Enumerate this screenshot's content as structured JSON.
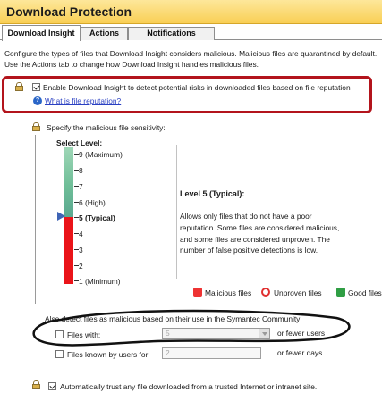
{
  "window": {
    "title": "Download Protection"
  },
  "tabs": [
    {
      "label": "Download Insight",
      "active": true
    },
    {
      "label": "Actions",
      "active": false
    },
    {
      "label": "Notifications",
      "active": false
    }
  ],
  "description": {
    "line1": "Configure the types of files that Download Insight considers malicious. Malicious files are quarantined by default.",
    "line2": "Use the Actions tab to change how Download Insight handles malicious files."
  },
  "enable_option": {
    "label": "Enable Download Insight to detect potential risks in downloaded files based on file reputation",
    "checked": true,
    "help_link": "What is file reputation?"
  },
  "sensitivity": {
    "heading": "Specify the malicious file sensitivity:",
    "select_label": "Select Level:",
    "levels": [
      "9 (Maximum)",
      "8",
      "7",
      "6 (High)",
      "5 (Typical)",
      "4",
      "3",
      "2",
      "1 (Minimum)"
    ],
    "selected_level": 5,
    "info_title": "Level 5 (Typical):",
    "info_text": "Allows only files that do not have a poor reputation. Some files are considered malicious, and some files are considered unproven. The number of false positive detections is low.",
    "legend": [
      "Malicious files",
      "Unproven files",
      "Good files"
    ]
  },
  "community": {
    "heading": "Also detect files as malicious based on their use in the Symantec Community:",
    "files_with_label": "Files with:",
    "files_with_checked": false,
    "files_with_value": "5",
    "files_with_suffix": "or fewer users",
    "known_by_label": "Files known by users for:",
    "known_by_checked": false,
    "known_by_value": "2",
    "known_by_suffix": "or fewer days"
  },
  "trust_option": {
    "label": "Automatically trust any file downloaded from a trusted Internet or intranet site.",
    "checked": true
  },
  "colors": {
    "title_bar": "#f9cf55",
    "annotation_red": "#b3141c",
    "red_zone": "#ea1419",
    "green_zone": "#6fbe98",
    "pointer": "#3e64b5",
    "link": "#2a40c2"
  }
}
